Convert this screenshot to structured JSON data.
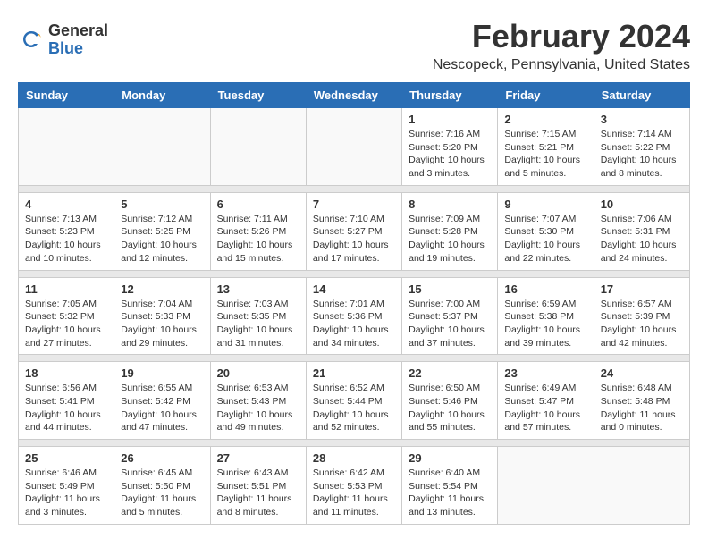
{
  "logo": {
    "general": "General",
    "blue": "Blue"
  },
  "title": {
    "month_year": "February 2024",
    "location": "Nescopeck, Pennsylvania, United States"
  },
  "headers": [
    "Sunday",
    "Monday",
    "Tuesday",
    "Wednesday",
    "Thursday",
    "Friday",
    "Saturday"
  ],
  "weeks": [
    [
      {
        "day": "",
        "info": ""
      },
      {
        "day": "",
        "info": ""
      },
      {
        "day": "",
        "info": ""
      },
      {
        "day": "",
        "info": ""
      },
      {
        "day": "1",
        "info": "Sunrise: 7:16 AM\nSunset: 5:20 PM\nDaylight: 10 hours\nand 3 minutes."
      },
      {
        "day": "2",
        "info": "Sunrise: 7:15 AM\nSunset: 5:21 PM\nDaylight: 10 hours\nand 5 minutes."
      },
      {
        "day": "3",
        "info": "Sunrise: 7:14 AM\nSunset: 5:22 PM\nDaylight: 10 hours\nand 8 minutes."
      }
    ],
    [
      {
        "day": "4",
        "info": "Sunrise: 7:13 AM\nSunset: 5:23 PM\nDaylight: 10 hours\nand 10 minutes."
      },
      {
        "day": "5",
        "info": "Sunrise: 7:12 AM\nSunset: 5:25 PM\nDaylight: 10 hours\nand 12 minutes."
      },
      {
        "day": "6",
        "info": "Sunrise: 7:11 AM\nSunset: 5:26 PM\nDaylight: 10 hours\nand 15 minutes."
      },
      {
        "day": "7",
        "info": "Sunrise: 7:10 AM\nSunset: 5:27 PM\nDaylight: 10 hours\nand 17 minutes."
      },
      {
        "day": "8",
        "info": "Sunrise: 7:09 AM\nSunset: 5:28 PM\nDaylight: 10 hours\nand 19 minutes."
      },
      {
        "day": "9",
        "info": "Sunrise: 7:07 AM\nSunset: 5:30 PM\nDaylight: 10 hours\nand 22 minutes."
      },
      {
        "day": "10",
        "info": "Sunrise: 7:06 AM\nSunset: 5:31 PM\nDaylight: 10 hours\nand 24 minutes."
      }
    ],
    [
      {
        "day": "11",
        "info": "Sunrise: 7:05 AM\nSunset: 5:32 PM\nDaylight: 10 hours\nand 27 minutes."
      },
      {
        "day": "12",
        "info": "Sunrise: 7:04 AM\nSunset: 5:33 PM\nDaylight: 10 hours\nand 29 minutes."
      },
      {
        "day": "13",
        "info": "Sunrise: 7:03 AM\nSunset: 5:35 PM\nDaylight: 10 hours\nand 31 minutes."
      },
      {
        "day": "14",
        "info": "Sunrise: 7:01 AM\nSunset: 5:36 PM\nDaylight: 10 hours\nand 34 minutes."
      },
      {
        "day": "15",
        "info": "Sunrise: 7:00 AM\nSunset: 5:37 PM\nDaylight: 10 hours\nand 37 minutes."
      },
      {
        "day": "16",
        "info": "Sunrise: 6:59 AM\nSunset: 5:38 PM\nDaylight: 10 hours\nand 39 minutes."
      },
      {
        "day": "17",
        "info": "Sunrise: 6:57 AM\nSunset: 5:39 PM\nDaylight: 10 hours\nand 42 minutes."
      }
    ],
    [
      {
        "day": "18",
        "info": "Sunrise: 6:56 AM\nSunset: 5:41 PM\nDaylight: 10 hours\nand 44 minutes."
      },
      {
        "day": "19",
        "info": "Sunrise: 6:55 AM\nSunset: 5:42 PM\nDaylight: 10 hours\nand 47 minutes."
      },
      {
        "day": "20",
        "info": "Sunrise: 6:53 AM\nSunset: 5:43 PM\nDaylight: 10 hours\nand 49 minutes."
      },
      {
        "day": "21",
        "info": "Sunrise: 6:52 AM\nSunset: 5:44 PM\nDaylight: 10 hours\nand 52 minutes."
      },
      {
        "day": "22",
        "info": "Sunrise: 6:50 AM\nSunset: 5:46 PM\nDaylight: 10 hours\nand 55 minutes."
      },
      {
        "day": "23",
        "info": "Sunrise: 6:49 AM\nSunset: 5:47 PM\nDaylight: 10 hours\nand 57 minutes."
      },
      {
        "day": "24",
        "info": "Sunrise: 6:48 AM\nSunset: 5:48 PM\nDaylight: 11 hours\nand 0 minutes."
      }
    ],
    [
      {
        "day": "25",
        "info": "Sunrise: 6:46 AM\nSunset: 5:49 PM\nDaylight: 11 hours\nand 3 minutes."
      },
      {
        "day": "26",
        "info": "Sunrise: 6:45 AM\nSunset: 5:50 PM\nDaylight: 11 hours\nand 5 minutes."
      },
      {
        "day": "27",
        "info": "Sunrise: 6:43 AM\nSunset: 5:51 PM\nDaylight: 11 hours\nand 8 minutes."
      },
      {
        "day": "28",
        "info": "Sunrise: 6:42 AM\nSunset: 5:53 PM\nDaylight: 11 hours\nand 11 minutes."
      },
      {
        "day": "29",
        "info": "Sunrise: 6:40 AM\nSunset: 5:54 PM\nDaylight: 11 hours\nand 13 minutes."
      },
      {
        "day": "",
        "info": ""
      },
      {
        "day": "",
        "info": ""
      }
    ]
  ]
}
